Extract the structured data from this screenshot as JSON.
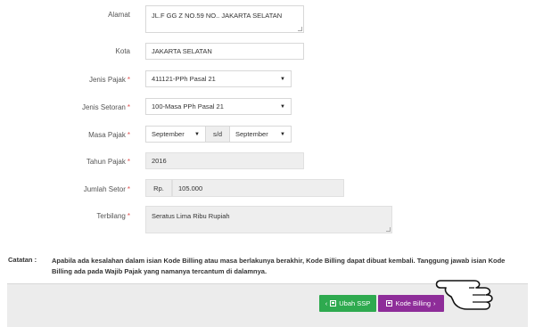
{
  "form": {
    "alamat": {
      "label": "Alamat",
      "value": "JL.F GG Z NO.59 NO.. JAKARTA SELATAN"
    },
    "kota": {
      "label": "Kota",
      "value": "JAKARTA SELATAN"
    },
    "jenis_pajak": {
      "label": "Jenis Pajak",
      "required": "*",
      "value": "411121-PPh Pasal 21"
    },
    "jenis_setoran": {
      "label": "Jenis Setoran",
      "required": "*",
      "value": "100-Masa PPh Pasal 21"
    },
    "masa_pajak": {
      "label": "Masa Pajak",
      "required": "*",
      "from": "September",
      "separator": "s/d",
      "to": "September"
    },
    "tahun_pajak": {
      "label": "Tahun Pajak",
      "required": "*",
      "value": "2016"
    },
    "jumlah_setor": {
      "label": "Jumlah Setor",
      "required": "*",
      "prefix": "Rp.",
      "value": "105.000"
    },
    "terbilang": {
      "label": "Terbilang",
      "required": "*",
      "value": "Seratus Lima Ribu  Rupiah"
    }
  },
  "note": {
    "label": "Catatan :",
    "text": "Apabila ada kesalahan dalam isian Kode Billing atau masa berlakunya berakhir, Kode Billing dapat dibuat kembali. Tanggung jawab isian Kode Billing ada pada Wajib Pajak yang namanya tercantum di dalamnya."
  },
  "buttons": {
    "ubah": {
      "label": "Ubah SSP",
      "prefix": "‹",
      "icon": "edit-icon",
      "color": "#2eaa4f"
    },
    "kode": {
      "label": "Kode Billing",
      "suffix": "›",
      "icon": "save-icon",
      "color": "#8e2d99"
    }
  },
  "decor": {
    "pointer": "hand-pointer-icon"
  }
}
